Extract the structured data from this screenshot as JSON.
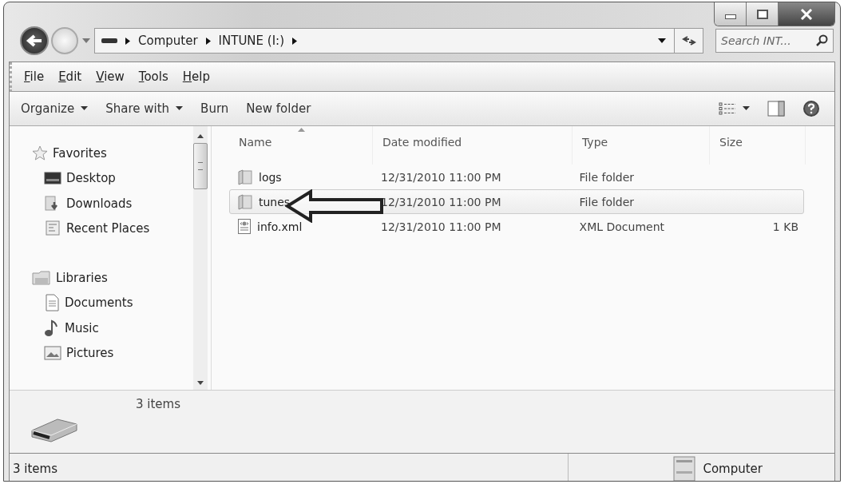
{
  "address_bar": {
    "crumbs": [
      "Computer",
      "INTUNE (I:)"
    ]
  },
  "search": {
    "placeholder": "Search INT..."
  },
  "menu_bar": [
    "File",
    "Edit",
    "View",
    "Tools",
    "Help"
  ],
  "toolbar": [
    {
      "label": "Organize",
      "dropdown": true
    },
    {
      "label": "Share with",
      "dropdown": true
    },
    {
      "label": "Burn",
      "dropdown": false
    },
    {
      "label": "New folder",
      "dropdown": false
    }
  ],
  "navigation": [
    {
      "label": "Favorites",
      "kind": "star",
      "children": [
        {
          "label": "Desktop",
          "kind": "desktop"
        },
        {
          "label": "Downloads",
          "kind": "downloads"
        },
        {
          "label": "Recent Places",
          "kind": "recent"
        }
      ]
    },
    {
      "label": "Libraries",
      "kind": "library",
      "children": [
        {
          "label": "Documents",
          "kind": "documents"
        },
        {
          "label": "Music",
          "kind": "music"
        },
        {
          "label": "Pictures",
          "kind": "pictures"
        }
      ]
    }
  ],
  "file_list": {
    "columns": [
      {
        "label": "Name",
        "sorted": true
      },
      {
        "label": "Date modified",
        "sorted": false
      },
      {
        "label": "Type",
        "sorted": false
      },
      {
        "label": "Size",
        "sorted": false
      }
    ],
    "rows": [
      {
        "kind": "folder",
        "name": "logs",
        "date": "12/31/2010 11:00 PM",
        "type": "File folder",
        "selected": false
      },
      {
        "kind": "folder",
        "name": "tunes",
        "date": "12/31/2010 11:00 PM",
        "type": "File folder",
        "selected": true
      },
      {
        "kind": "xml",
        "name": "info.xml",
        "date": "12/31/2010 11:00 PM",
        "type": "XML Document",
        "size": "1 KB",
        "selected": false
      }
    ]
  },
  "details_pane": {
    "count": "3 items"
  },
  "status_bar": {
    "count": "3 items",
    "location": "Computer"
  }
}
